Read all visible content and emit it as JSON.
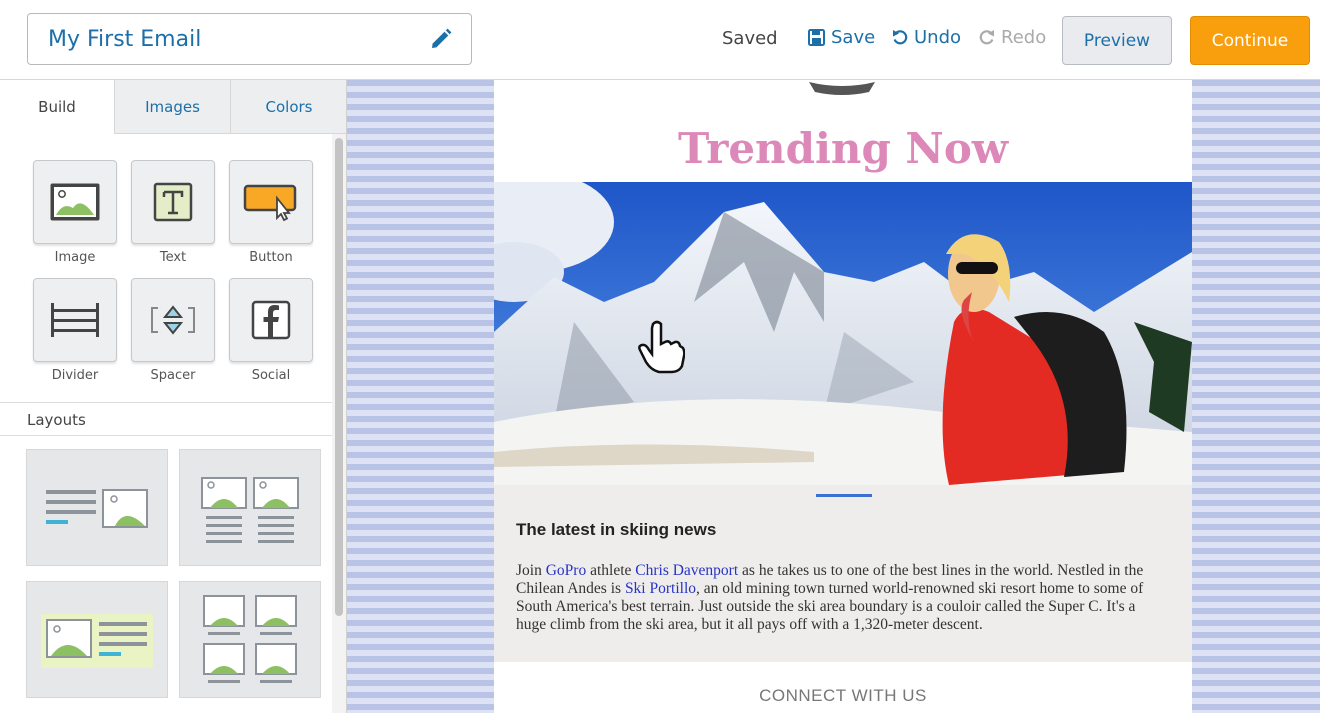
{
  "header": {
    "email_title": "My First Email",
    "status": "Saved",
    "save_label": "Save",
    "undo_label": "Undo",
    "redo_label": "Redo",
    "preview_label": "Preview",
    "continue_label": "Continue"
  },
  "panel": {
    "tabs": [
      {
        "label": "Build"
      },
      {
        "label": "Images"
      },
      {
        "label": "Colors"
      }
    ],
    "blocks": [
      {
        "label": "Image",
        "icon": "image-icon"
      },
      {
        "label": "Text",
        "icon": "text-icon"
      },
      {
        "label": "Button",
        "icon": "button-icon"
      },
      {
        "label": "Divider",
        "icon": "divider-icon"
      },
      {
        "label": "Spacer",
        "icon": "spacer-icon"
      },
      {
        "label": "Social",
        "icon": "facebook-icon"
      }
    ],
    "layouts_heading": "Layouts"
  },
  "email": {
    "heading": "Trending Now",
    "article_title": "The latest in skiing news",
    "article_body": {
      "t1": "Join ",
      "link1": "GoPro",
      "t2": " athlete ",
      "link2": "Chris Davenport",
      "t3": " as he takes us to one of the best lines in the world. Nestled in the Chilean Andes is ",
      "link3": "Ski Portillo",
      "t4": ", an old mining town turned world-renowned ski resort home to some of South America's best terrain. Just outside the ski area boundary is a couloir called the Super C. It's a huge climb from the ski area, but it all pays off with a 1,320-meter descent."
    },
    "connect_label": "CONNECT WITH US"
  },
  "colors": {
    "accent": "#1c6fa8",
    "continue_bg": "#f99f0d",
    "heading_pink": "#dc88b8",
    "link_blue": "#2633c6"
  }
}
